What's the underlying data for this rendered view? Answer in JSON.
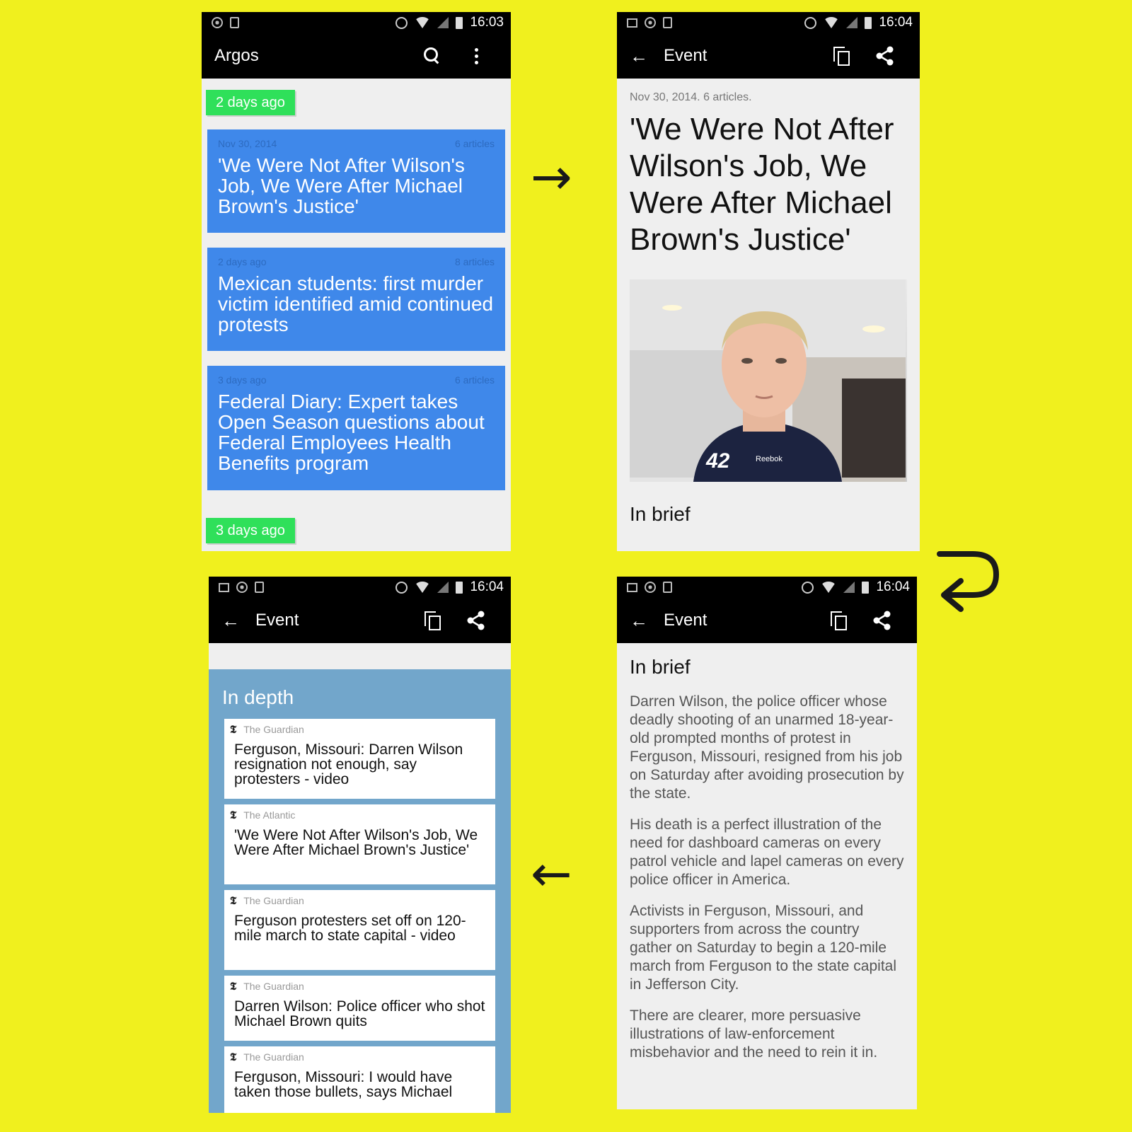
{
  "screen1": {
    "status": {
      "time": "16:03"
    },
    "appbar": {
      "title": "Argos"
    },
    "chips": [
      "2 days ago",
      "3 days ago"
    ],
    "cards": [
      {
        "date": "Nov 30, 2014",
        "count": "6 articles",
        "title": "'We Were Not After Wilson's Job, We Were After Michael Brown's Justice'"
      },
      {
        "date": "2 days ago",
        "count": "8 articles",
        "title": "Mexican students: first murder victim identified amid continued protests"
      },
      {
        "date": "3 days ago",
        "count": "6 articles",
        "title": "Federal Diary: Expert takes Open Season questions about Federal Employees Health Benefits program"
      }
    ]
  },
  "screen2": {
    "status": {
      "time": "16:04"
    },
    "appbar": {
      "back": "←",
      "title": "Event"
    },
    "meta": "Nov 30, 2014. 6 articles.",
    "headline": "'We Were Not After Wilson's Job, We Were After Michael Brown's Justice'",
    "photo": {
      "shirt_number": "42",
      "shirt_brand": "Reebok"
    },
    "section": "In brief"
  },
  "screen3": {
    "status": {
      "time": "16:04"
    },
    "appbar": {
      "back": "←",
      "title": "Event"
    },
    "section": "In brief",
    "paragraphs": [
      "Darren Wilson, the police officer whose deadly shooting of an unarmed 18-year-old prompted months of protest in Ferguson, Missouri, resigned from his job on Saturday after avoiding prosecution by the state.",
      "His death is a perfect illustration of the need for dashboard cameras on every patrol vehicle and lapel cameras on every police officer in America.",
      "Activists in Ferguson, Missouri, and supporters from across the country gather on Saturday to begin a 120-mile march from Ferguson to the state capital in Jefferson City.",
      "There are clearer, more persuasive illustrations of law-enforcement misbehavior and the need to rein it in."
    ]
  },
  "screen4": {
    "status": {
      "time": "16:04"
    },
    "appbar": {
      "back": "←",
      "title": "Event"
    },
    "section": "In depth",
    "articles": [
      {
        "source": "The Guardian",
        "title": "Ferguson, Missouri: Darren Wilson resignation not enough, say protesters - video"
      },
      {
        "source": "The Atlantic",
        "title": "'We Were Not After Wilson's Job, We Were After Michael Brown's Justice'"
      },
      {
        "source": "The Guardian",
        "title": "Ferguson protesters set off on 120-mile march to state capital - video"
      },
      {
        "source": "The Guardian",
        "title": "Darren Wilson: Police officer who shot Michael Brown quits"
      },
      {
        "source": "The Guardian",
        "title": "Ferguson, Missouri: I would have taken those bullets, says Michael"
      }
    ]
  },
  "arrows": {
    "right": "→",
    "left": "←",
    "return": "↩"
  },
  "colors": {
    "background": "#f0f01e",
    "card": "#3f88ea",
    "chip": "#2fe05a",
    "depth": "#72a6cb"
  }
}
